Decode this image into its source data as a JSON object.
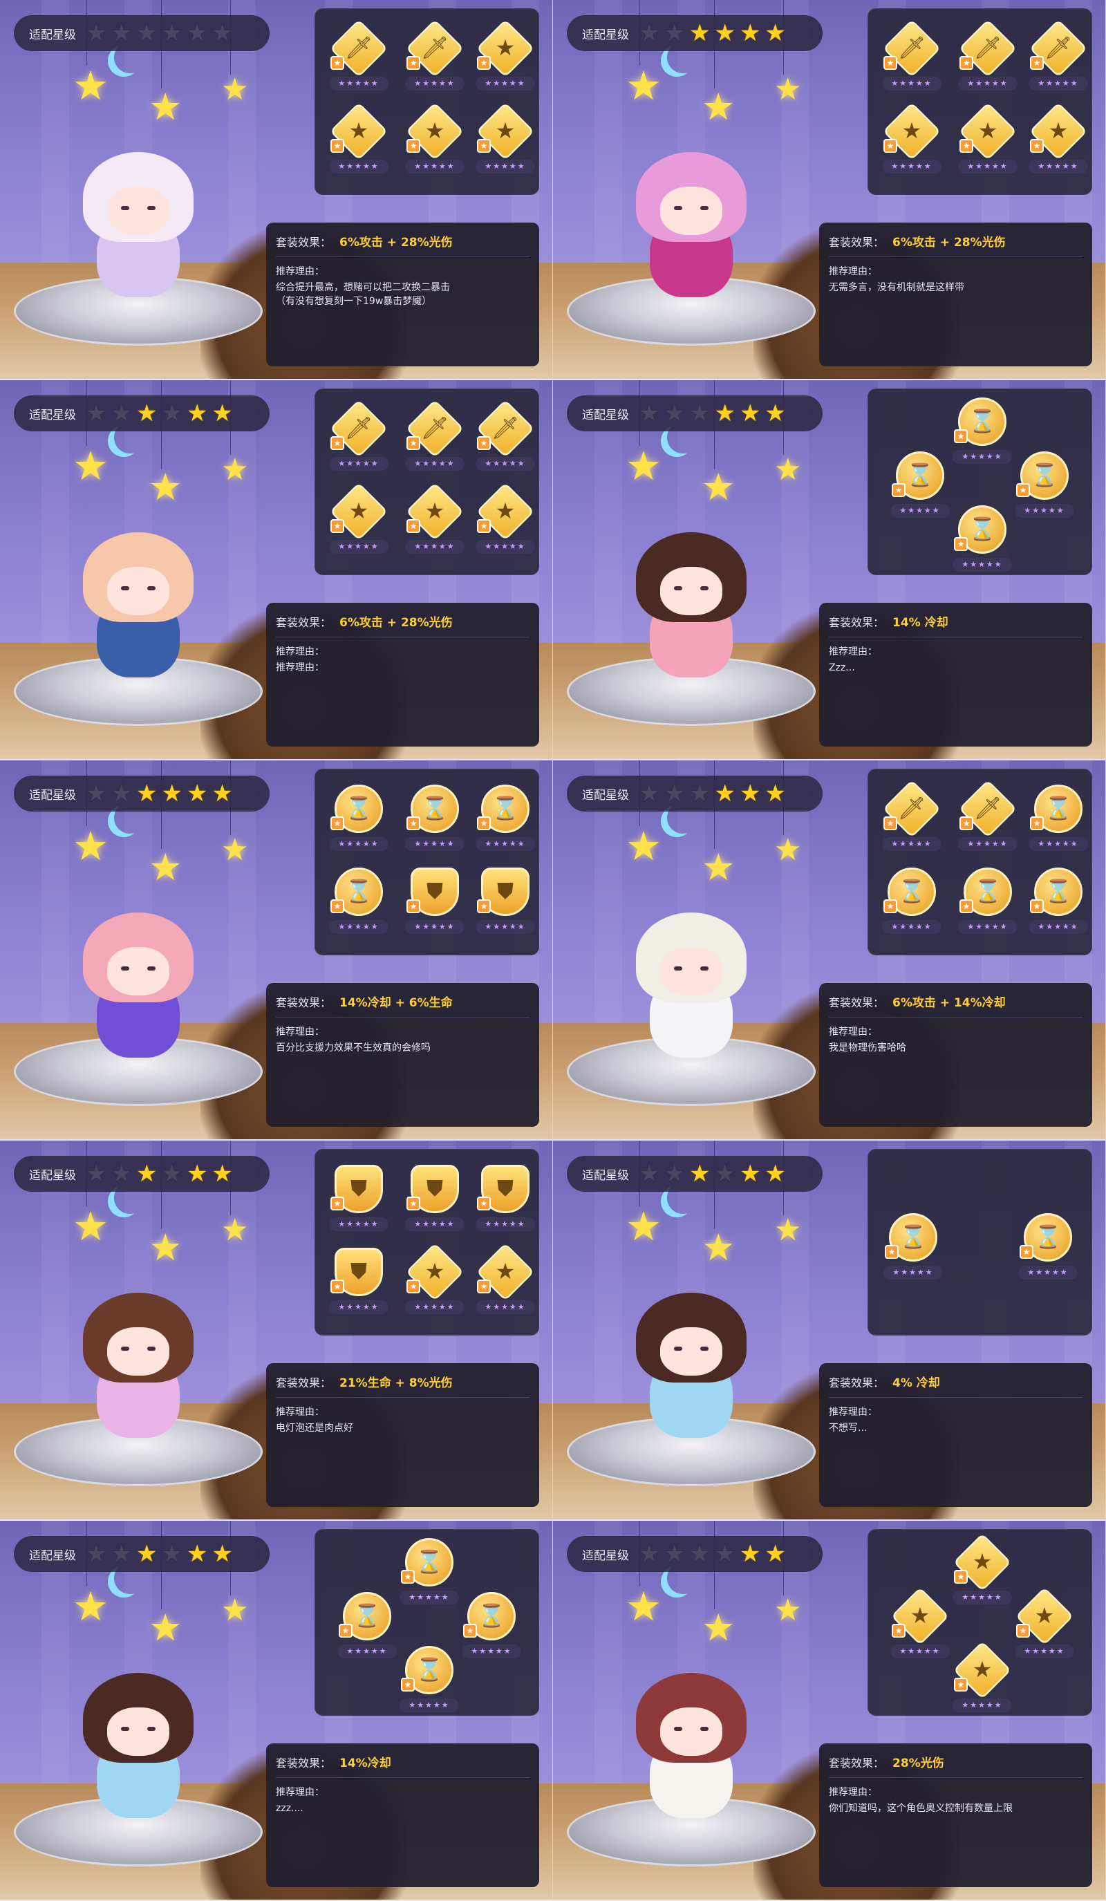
{
  "colors": {
    "star_on": "#ffd21f",
    "star_off": "#4a4660",
    "set_effect": "#ffcf33"
  },
  "labels": {
    "star_bar": "适配星级",
    "set_effect": "套装效果：",
    "reason": "推荐理由："
  },
  "cells": [
    {
      "stars": [
        false,
        false,
        false,
        false,
        false,
        false
      ],
      "set_effect": "6%攻击 + 28%光伤",
      "reason": "综合提升最高，想赌可以把二攻换二暴击\n（有没有想复刻一下19w暴击梦魇）",
      "reason_label_count": 1,
      "equip_layout": "grid6",
      "equips": [
        "sword",
        "sword",
        "star",
        "star",
        "star",
        "star"
      ],
      "equip_ratings": [
        "★★★★★",
        "★★★★★",
        "★★★★★",
        "★★★★★",
        "★★★★★",
        "★★★★★"
      ],
      "character": {
        "name": "demon-wing-girl",
        "hair": "#f3eaf6",
        "body": "#d9c6f0"
      }
    },
    {
      "stars": [
        false,
        false,
        true,
        true,
        true,
        true
      ],
      "set_effect": "6%攻击 + 28%光伤",
      "reason": "无需多言，没有机制就是这样带",
      "reason_label_count": 1,
      "equip_layout": "grid6",
      "equips": [
        "sword",
        "sword",
        "sword",
        "star",
        "star",
        "star"
      ],
      "equip_ratings": [
        "★★★★★",
        "★★★★★",
        "★★★★★",
        "★★★★★",
        "★★★★★",
        "★★★★★"
      ],
      "character": {
        "name": "pink-twintail-girl",
        "hair": "#e99ad8",
        "body": "#c9378a"
      }
    },
    {
      "stars": [
        false,
        false,
        true,
        false,
        true,
        true
      ],
      "set_effect": "6%攻击 + 28%光伤",
      "reason": "推荐理由：",
      "reason_label_count": 1,
      "equip_layout": "grid6",
      "equips": [
        "sword",
        "sword",
        "sword",
        "star",
        "star",
        "star"
      ],
      "equip_ratings": [
        "★★★★★",
        "★★★★★",
        "★★★★★",
        "★★★★★",
        "★★★★★",
        "★★★★★"
      ],
      "character": {
        "name": "sailor-star-girl",
        "hair": "#f6c7a8",
        "body": "#3a5ea8"
      }
    },
    {
      "stars": [
        false,
        false,
        false,
        true,
        true,
        true
      ],
      "set_effect": "14% 冷却",
      "reason": "Zzz...",
      "reason_label_count": 1,
      "equip_layout": "cross4",
      "equips": [
        "hourglass",
        "hourglass",
        "hourglass",
        "hourglass"
      ],
      "equip_ratings": [
        "★★★★★",
        "★★★★★",
        "★★★★★",
        "★★★★★"
      ],
      "character": {
        "name": "panda-hood-girl",
        "hair": "#4a2a22",
        "body": "#f4a3b8"
      }
    },
    {
      "stars": [
        false,
        false,
        true,
        true,
        true,
        true
      ],
      "set_effect": "14%冷却 + 6%生命",
      "reason": "百分比支援力效果不生效真的会修吗",
      "reason_label_count": 1,
      "equip_layout": "grid6",
      "equips": [
        "hourglass",
        "hourglass",
        "hourglass",
        "hourglass",
        "shield",
        "shield"
      ],
      "equip_ratings": [
        "★★★★★",
        "★★★★★",
        "★★★★★",
        "★★★★★",
        "★★★★★",
        "★★★★★"
      ],
      "character": {
        "name": "bunny-planet-girl",
        "hair": "#f4a9b8",
        "body": "#6f4fd6"
      }
    },
    {
      "stars": [
        false,
        false,
        false,
        true,
        true,
        true
      ],
      "set_effect": "6%攻击 + 14%冷却",
      "reason": "我是物理伤害哈哈",
      "reason_label_count": 1,
      "equip_layout": "grid6",
      "equips": [
        "sword",
        "sword",
        "hourglass",
        "hourglass",
        "hourglass",
        "hourglass"
      ],
      "equip_ratings": [
        "★★★★★",
        "★★★★★",
        "★★★★★",
        "★★★★★",
        "★★★★★",
        "★★★★★"
      ],
      "character": {
        "name": "astronaut-girl",
        "hair": "#f1eee6",
        "body": "#f4f4f6"
      }
    },
    {
      "stars": [
        false,
        false,
        true,
        false,
        true,
        true
      ],
      "set_effect": "21%生命 + 8%光伤",
      "reason": "电灯泡还是肉点好",
      "reason_label_count": 1,
      "equip_layout": "grid6",
      "equips": [
        "shield",
        "shield",
        "shield",
        "shield",
        "star",
        "star"
      ],
      "equip_ratings": [
        "★★★★★",
        "★★★★★",
        "★★★★★",
        "★★★★★",
        "★★★★★",
        "★★★★★"
      ],
      "character": {
        "name": "moon-bunny-girl",
        "hair": "#6a3b2a",
        "body": "#e8b3e6"
      }
    },
    {
      "stars": [
        false,
        false,
        true,
        false,
        true,
        true
      ],
      "set_effect": "4% 冷却",
      "reason": "不想写...",
      "reason_label_count": 1,
      "equip_layout": "pair2",
      "equips": [
        "hourglass",
        "hourglass"
      ],
      "equip_ratings": [
        "★★★★★",
        "★★★★★"
      ],
      "character": {
        "name": "whale-hood-girl",
        "hair": "#4a2a22",
        "body": "#9fd6f2"
      }
    },
    {
      "stars": [
        false,
        false,
        true,
        false,
        true,
        true
      ],
      "set_effect": "14%冷却",
      "reason": "zzz....",
      "reason_label_count": 1,
      "equip_layout": "cross4",
      "equips": [
        "hourglass",
        "hourglass",
        "hourglass",
        "hourglass"
      ],
      "equip_ratings": [
        "★★★★★",
        "★★★★★",
        "★★★★★",
        "★★★★★"
      ],
      "character": {
        "name": "whale-hood-girl-2",
        "hair": "#4a2a22",
        "body": "#9fd6f2"
      }
    },
    {
      "stars": [
        false,
        false,
        false,
        false,
        true,
        true
      ],
      "set_effect": "28%光伤",
      "reason": "你们知道吗，这个角色奥义控制有数量上限",
      "reason_label_count": 1,
      "equip_layout": "cross4",
      "equips": [
        "star",
        "star",
        "star",
        "star"
      ],
      "equip_ratings": [
        "★★★★★",
        "★★★★★",
        "★★★★★",
        "★★★★★"
      ],
      "character": {
        "name": "fluffy-cloud-girl",
        "hair": "#8e3a3a",
        "body": "#f6f2ee"
      }
    }
  ]
}
